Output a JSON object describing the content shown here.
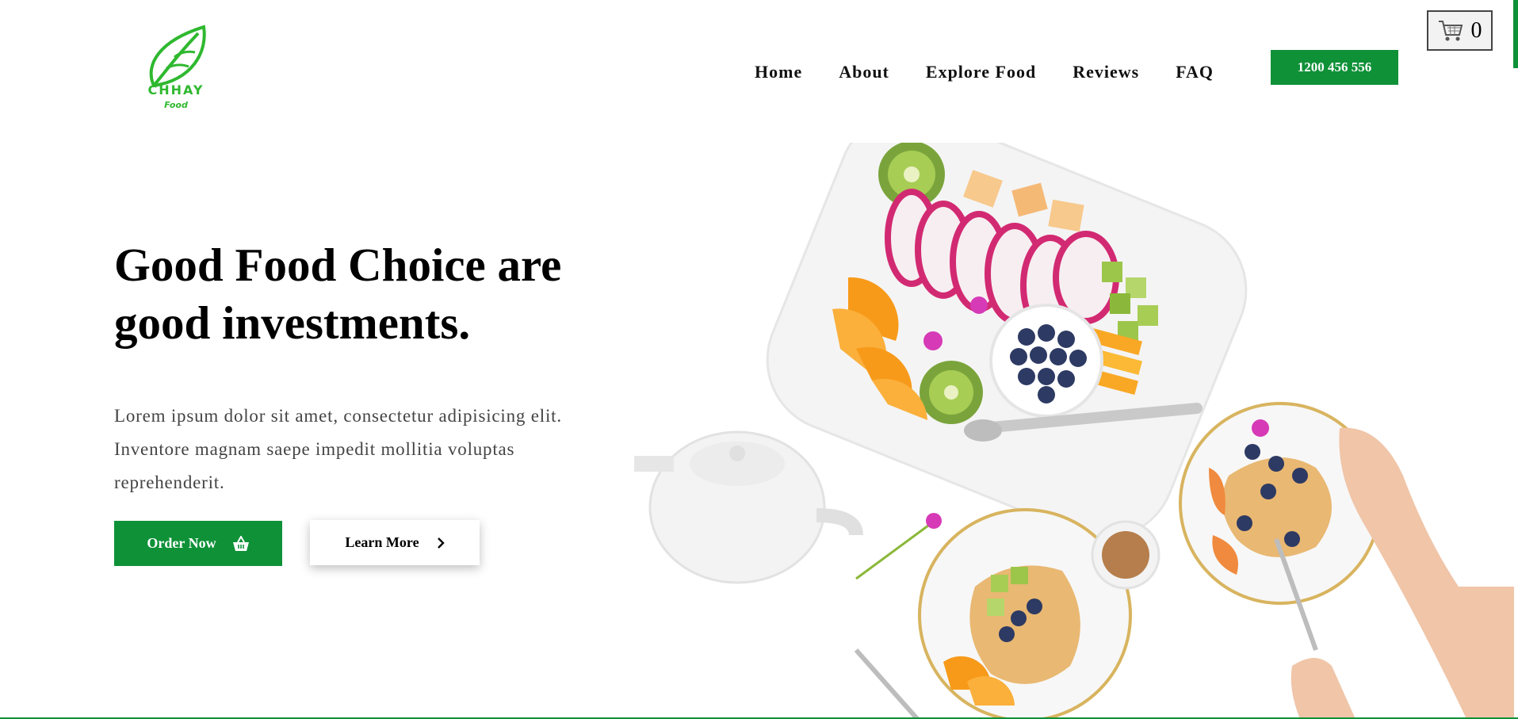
{
  "brand": {
    "logo_word": "CHHAY",
    "logo_sub": "Food",
    "color": "#2fb82f"
  },
  "nav": {
    "items": [
      {
        "label": "Home"
      },
      {
        "label": "About"
      },
      {
        "label": "Explore Food"
      },
      {
        "label": "Reviews"
      },
      {
        "label": "FAQ"
      }
    ],
    "phone_label": "1200 456 556"
  },
  "cart": {
    "icon": "shopping-cart-icon",
    "count": "0"
  },
  "hero": {
    "title_line1": "Good Food Choice are",
    "title_line2": "good investments.",
    "description_line1": "Lorem ipsum dolor sit amet, consectetur adipisicing elit.",
    "description_line2": "Inventore magnam saepe impedit mollitia voluptas",
    "description_line3": "reprehenderit.",
    "order_button": "Order Now",
    "order_icon": "basket-icon",
    "learn_button": "Learn More",
    "learn_icon": "chevron-right-icon"
  },
  "colors": {
    "accent": "#0f9138",
    "text": "#000000",
    "muted": "#444444"
  }
}
